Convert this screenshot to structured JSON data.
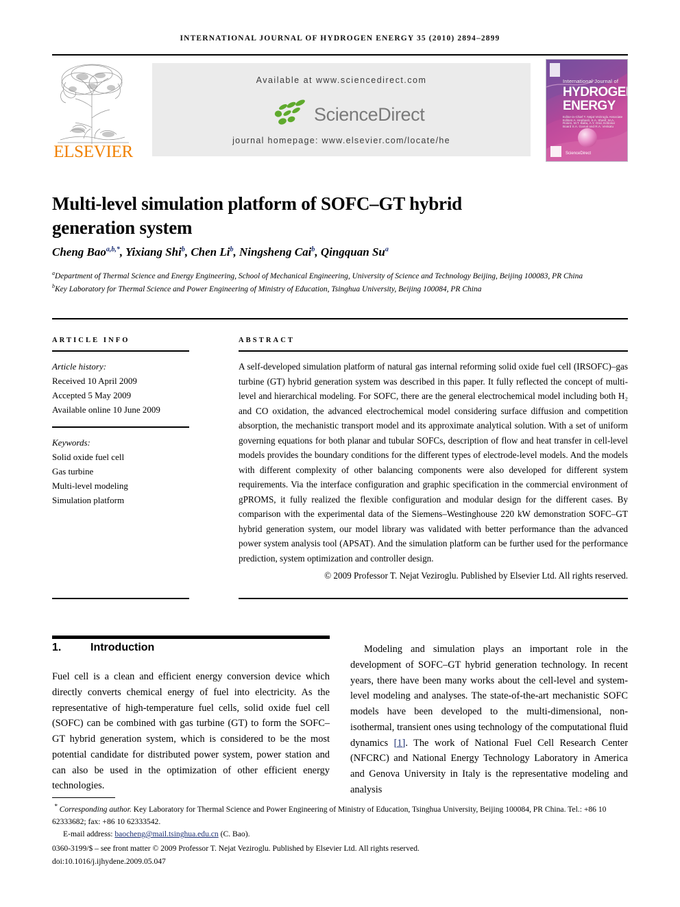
{
  "running_head": "INTERNATIONAL JOURNAL OF HYDROGEN ENERGY 35 (2010) 2894–2899",
  "masthead": {
    "publisher_name": "ELSEVIER",
    "available_at": "Available at www.sciencedirect.com",
    "sciencedirect_label": "ScienceDirect",
    "journal_homepage": "journal homepage: www.elsevier.com/locate/he",
    "cover": {
      "kicker": "International Journal of",
      "line1": "HYDROGEN",
      "line2": "ENERGY",
      "editors": "Editor-in-Chief  T. Nejat Veziroglu    Associate Editors  A. Hepbasli, S.A. Sherif, M.A. Rosen, M.T. Balta, A.Y. Oral, Editorial Board    S.A. Gamal and R.A. Venkatu",
      "sciencedirect": "ScienceDirect"
    },
    "colors": {
      "elsevier_orange": "#f08000",
      "band_grey": "#ebebeb",
      "sciencedirect_green": "#5faa2d",
      "sciencedirect_grey": "#7a7a7a",
      "cover_purple": "#8d4f9e",
      "cover_magenta": "#c0449a"
    }
  },
  "article": {
    "title": "Multi-level simulation platform of SOFC–GT hybrid generation system",
    "authors": [
      {
        "name": "Cheng Bao",
        "sup": "a,b,*"
      },
      {
        "name": "Yixiang Shi",
        "sup": "b"
      },
      {
        "name": "Chen Li",
        "sup": "b"
      },
      {
        "name": "Ningsheng Cai",
        "sup": "b"
      },
      {
        "name": "Qingquan Su",
        "sup": "a"
      }
    ],
    "affiliations": [
      {
        "label": "a",
        "text": "Department of Thermal Science and Energy Engineering, School of Mechanical Engineering, University of Science and Technology Beijing, Beijing 100083, PR China"
      },
      {
        "label": "b",
        "text": "Key Laboratory for Thermal Science and Power Engineering of Ministry of Education, Tsinghua University, Beijing 100084, PR China"
      }
    ]
  },
  "article_info": {
    "heading": "ARTICLE INFO",
    "history_label": "Article history:",
    "history": [
      "Received 10 April 2009",
      "Accepted 5 May 2009",
      "Available online 10 June 2009"
    ],
    "keywords_label": "Keywords:",
    "keywords": [
      "Solid oxide fuel cell",
      "Gas turbine",
      "Multi-level modeling",
      "Simulation platform"
    ]
  },
  "abstract": {
    "heading": "ABSTRACT",
    "text": "A self-developed simulation platform of natural gas internal reforming solid oxide fuel cell (IRSOFC)–gas turbine (GT) hybrid generation system was described in this paper. It fully reflected the concept of multi-level and hierarchical modeling. For SOFC, there are the general electrochemical model including both H₂ and CO oxidation, the advanced electrochemical model considering surface diffusion and competition absorption, the mechanistic transport model and its approximate analytical solution. With a set of uniform governing equations for both planar and tubular SOFCs, description of flow and heat transfer in cell-level models provides the boundary conditions for the different types of electrode-level models. And the models with different complexity of other balancing components were also developed for different system requirements. Via the interface configuration and graphic specification in the commercial environment of gPROMS, it fully realized the flexible configuration and modular design for the different cases. By comparison with the experimental data of the Siemens–Westinghouse 220 kW demonstration SOFC–GT hybrid generation system, our model library was validated with better performance than the advanced power system analysis tool (APSAT). And the simulation platform can be further used for the performance prediction, system optimization and controller design.",
    "copyright": "© 2009 Professor T. Nejat Veziroglu. Published by Elsevier Ltd. All rights reserved."
  },
  "body": {
    "section_number": "1.",
    "section_title": "Introduction",
    "left_paragraph": "Fuel cell is a clean and efficient energy conversion device which directly converts chemical energy of fuel into electricity. As the representative of high-temperature fuel cells, solid oxide fuel cell (SOFC) can be combined with gas turbine (GT) to form the SOFC–GT hybrid generation system, which is considered to be the most potential candidate for distributed power system, power station and can also be used in the optimization of other efficient energy technologies.",
    "right_paragraph_part1": "Modeling and simulation plays an important role in the development of SOFC–GT hybrid generation technology. In recent years, there have been many works about the cell-level and system-level modeling and analyses. The state-of-the-art mechanistic SOFC models have been developed to the multi-dimensional, non-isothermal, transient ones using technology of the computational fluid dynamics ",
    "right_reference": "[1]",
    "right_paragraph_part2": ". The work of National Fuel Cell Research Center (NFCRC) and National Energy Technology Laboratory in America and Genova University in Italy is the representative modeling and analysis"
  },
  "footnotes": {
    "corresponding_marker": "*",
    "corresponding_label": "Corresponding author.",
    "corresponding_text": " Key Laboratory for Thermal Science and Power Engineering of Ministry of Education, Tsinghua University, Beijing 100084, PR China. Tel.: +86 10 62333682; fax: +86 10 62333542.",
    "email_label": "E-mail address:",
    "email": "baocheng@mail.tsinghua.edu.cn",
    "email_suffix": "(C. Bao).",
    "issn_line": "0360-3199/$ – see front matter © 2009 Professor T. Nejat Veziroglu. Published by Elsevier Ltd. All rights reserved.",
    "doi_line": "doi:10.1016/j.ijhydene.2009.05.047"
  }
}
